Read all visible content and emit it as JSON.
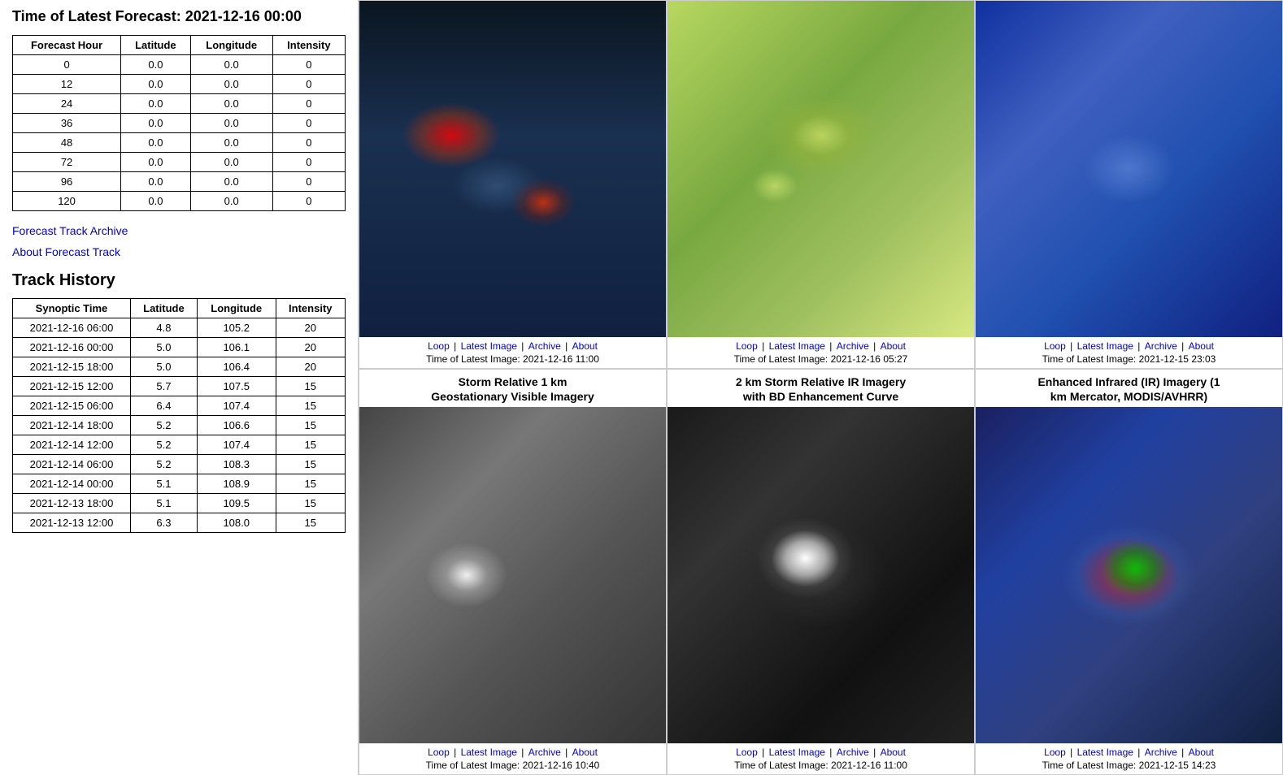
{
  "left": {
    "forecast_time_label": "Time of Latest Forecast: 2021-12-16 00:00",
    "forecast_table": {
      "headers": [
        "Forecast Hour",
        "Latitude",
        "Longitude",
        "Intensity"
      ],
      "rows": [
        [
          "0",
          "0.0",
          "0.0",
          "0"
        ],
        [
          "12",
          "0.0",
          "0.0",
          "0"
        ],
        [
          "24",
          "0.0",
          "0.0",
          "0"
        ],
        [
          "36",
          "0.0",
          "0.0",
          "0"
        ],
        [
          "48",
          "0.0",
          "0.0",
          "0"
        ],
        [
          "72",
          "0.0",
          "0.0",
          "0"
        ],
        [
          "96",
          "0.0",
          "0.0",
          "0"
        ],
        [
          "120",
          "0.0",
          "0.0",
          "0"
        ]
      ]
    },
    "forecast_track_archive_link": "Forecast Track Archive",
    "about_forecast_track_link": "About Forecast Track",
    "track_history_title": "Track History",
    "track_table": {
      "headers": [
        "Synoptic Time",
        "Latitude",
        "Longitude",
        "Intensity"
      ],
      "rows": [
        [
          "2021-12-16 06:00",
          "4.8",
          "105.2",
          "20"
        ],
        [
          "2021-12-16 00:00",
          "5.0",
          "106.1",
          "20"
        ],
        [
          "2021-12-15 18:00",
          "5.0",
          "106.4",
          "20"
        ],
        [
          "2021-12-15 12:00",
          "5.7",
          "107.5",
          "15"
        ],
        [
          "2021-12-15 06:00",
          "6.4",
          "107.4",
          "15"
        ],
        [
          "2021-12-14 18:00",
          "5.2",
          "106.6",
          "15"
        ],
        [
          "2021-12-14 12:00",
          "5.2",
          "107.4",
          "15"
        ],
        [
          "2021-12-14 06:00",
          "5.2",
          "108.3",
          "15"
        ],
        [
          "2021-12-14 00:00",
          "5.1",
          "108.9",
          "15"
        ],
        [
          "2021-12-13 18:00",
          "5.1",
          "109.5",
          "15"
        ],
        [
          "2021-12-13 12:00",
          "6.3",
          "108.0",
          "15"
        ]
      ]
    }
  },
  "panels": [
    {
      "id": "panel1",
      "title": "",
      "links": [
        "Loop",
        "Latest Image",
        "Archive",
        "About"
      ],
      "time_label": "Time of Latest Image: 2021-12-16 11:00",
      "img_class": "sat-vis1"
    },
    {
      "id": "panel2",
      "title": "",
      "links": [
        "Loop",
        "Latest Image",
        "Archive",
        "About"
      ],
      "time_label": "Time of Latest Image: 2021-12-16 05:27",
      "img_class": "sat-wind1"
    },
    {
      "id": "panel3",
      "title": "",
      "links": [
        "Loop",
        "Latest Image",
        "Archive",
        "About"
      ],
      "time_label": "Time of Latest Image: 2021-12-15 23:03",
      "img_class": "sat-rgb1"
    },
    {
      "id": "panel4",
      "title": "Storm Relative 1 km\nGeostationary Visible Imagery",
      "links": [
        "Loop",
        "Latest Image",
        "Archive",
        "About"
      ],
      "time_label": "Time of Latest Image: 2021-12-16 10:40",
      "img_class": "sat-vis2"
    },
    {
      "id": "panel5",
      "title": "2 km Storm Relative IR Imagery\nwith BD Enhancement Curve",
      "links": [
        "Loop",
        "Latest Image",
        "Archive",
        "About"
      ],
      "time_label": "Time of Latest Image: 2021-12-16 11:00",
      "img_class": "sat-ir1"
    },
    {
      "id": "panel6",
      "title": "Enhanced Infrared (IR) Imagery (1\nkm Mercator, MODIS/AVHRR)",
      "links": [
        "Loop",
        "Latest Image",
        "Archive",
        "About"
      ],
      "time_label": "Time of Latest Image: 2021-12-15 14:23",
      "img_class": "sat-enhanced1"
    }
  ]
}
